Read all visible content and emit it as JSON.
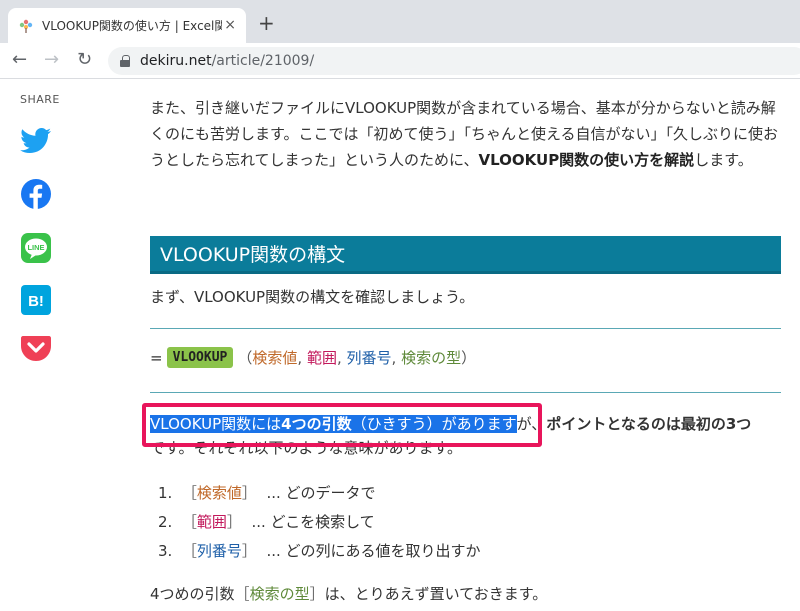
{
  "browser": {
    "tab_title": "VLOOKUP関数の使い方 | Excel関数",
    "tab_close": "×",
    "new_tab": "+",
    "url_domain": "dekiru.net",
    "url_path": "/article/21009/",
    "back": "←",
    "forward": "→",
    "reload": "↻"
  },
  "share": {
    "label": "SHARE",
    "icons": [
      "twitter-icon",
      "facebook-icon",
      "line-icon",
      "hatena-bookmark-icon",
      "pocket-icon"
    ],
    "line_text": "LINE",
    "hatena_text": "B!"
  },
  "colors": {
    "twitter": "#1da1f2",
    "facebook": "#1877f2",
    "line": "#3ac24a",
    "hatena": "#00a4de",
    "pocket": "#ef4056",
    "heading_bg": "#0b7c9a",
    "selection": "#1a73e8",
    "annotation_box": "#e8155b"
  },
  "article": {
    "intro_1": "また、引き継いだファイルにVLOOKUP関数が含まれている場合、基本が分からないと読み解くのにも苦労します。ここでは「初めて使う」「ちゃんと使える自信がない」「久しぶりに使おうとしたら忘れてしまった」という人のために、",
    "intro_bold": "VLOOKUP関数の使い方を解説",
    "intro_2": "します。",
    "heading": "VLOOKUP関数の構文",
    "syntax_intro": "まず、VLOOKUP関数の構文を確認しましょう。",
    "syntax_eq": "=",
    "syntax_fn": "VLOOKUP",
    "syntax_open": "（",
    "arg1": "検索値",
    "arg2": "範囲",
    "arg3": "列番号",
    "arg4": "検索の型",
    "comma": ", ",
    "syntax_close": "）",
    "highlight_pre": "VLOOKUP関数には",
    "highlight_bold": "4つの引数",
    "highlight_post": "（ひきすう）があります",
    "highlight_rest_plain": "が、",
    "highlight_rest_bold": "ポイントとなるのは最初の3つ",
    "second_line": "です。それぞれ以下のような意味があります。",
    "list": [
      {
        "num": "1.",
        "arg": "検索値",
        "desc": "... どのデータで"
      },
      {
        "num": "2.",
        "arg": "範囲",
        "desc": "... どこを検索して"
      },
      {
        "num": "3.",
        "arg": "列番号",
        "desc": "... どの列にある値を取り出すか"
      }
    ],
    "bracket_open": "［",
    "bracket_close": "］",
    "last_pre": "4つめの引数",
    "last_arg": "検索の型",
    "last_post": "は、とりあえず置いておきます。"
  }
}
